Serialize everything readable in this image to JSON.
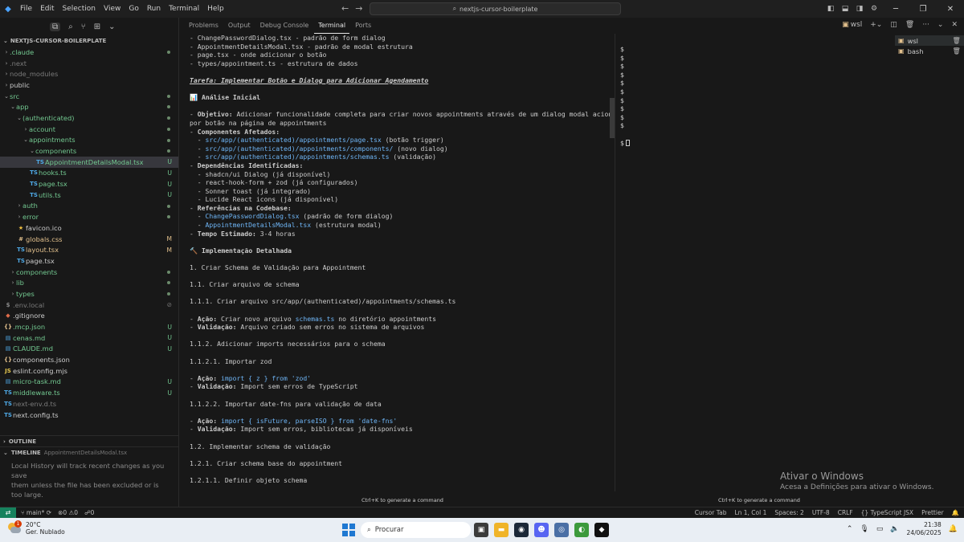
{
  "titlebar": {
    "menu": [
      "File",
      "Edit",
      "Selection",
      "View",
      "Go",
      "Run",
      "Terminal",
      "Help"
    ],
    "search": "nextjs-cursor-boilerplate"
  },
  "explorer": {
    "title": "NEXTJS-CURSOR-BOILERPLATE",
    "items": [
      {
        "name": ".claude",
        "depth": 0,
        "type": "folder",
        "open": false,
        "status": "dot",
        "color": "git"
      },
      {
        "name": ".next",
        "depth": 0,
        "type": "folder",
        "open": false,
        "status": "",
        "color": "dim"
      },
      {
        "name": "node_modules",
        "depth": 0,
        "type": "folder",
        "open": false,
        "status": "",
        "color": "dim"
      },
      {
        "name": "public",
        "depth": 0,
        "type": "folder",
        "open": false,
        "status": "",
        "color": "normal"
      },
      {
        "name": "src",
        "depth": 0,
        "type": "folder",
        "open": true,
        "status": "dot",
        "color": "git"
      },
      {
        "name": "app",
        "depth": 1,
        "type": "folder",
        "open": true,
        "status": "dot",
        "color": "git"
      },
      {
        "name": "(authenticated)",
        "depth": 2,
        "type": "folder",
        "open": true,
        "status": "dot",
        "color": "git"
      },
      {
        "name": "account",
        "depth": 3,
        "type": "folder",
        "open": false,
        "status": "dot",
        "color": "git"
      },
      {
        "name": "appointments",
        "depth": 3,
        "type": "folder",
        "open": true,
        "status": "dot",
        "color": "git"
      },
      {
        "name": "components",
        "depth": 4,
        "type": "folder",
        "open": true,
        "status": "dot",
        "color": "git"
      },
      {
        "name": "AppointmentDetailsModal.tsx",
        "depth": 5,
        "type": "tsx",
        "status": "U",
        "color": "git",
        "selected": true
      },
      {
        "name": "hooks.ts",
        "depth": 4,
        "type": "ts",
        "status": "U",
        "color": "git"
      },
      {
        "name": "page.tsx",
        "depth": 4,
        "type": "tsx",
        "status": "U",
        "color": "git"
      },
      {
        "name": "utils.ts",
        "depth": 4,
        "type": "ts",
        "status": "U",
        "color": "git"
      },
      {
        "name": "auth",
        "depth": 2,
        "type": "folder",
        "open": false,
        "status": "dot",
        "color": "git"
      },
      {
        "name": "error",
        "depth": 2,
        "type": "folder",
        "open": false,
        "status": "dot",
        "color": "git"
      },
      {
        "name": "favicon.ico",
        "depth": 2,
        "type": "ico",
        "status": "",
        "color": "normal"
      },
      {
        "name": "globals.css",
        "depth": 2,
        "type": "css",
        "status": "M",
        "color": "mod"
      },
      {
        "name": "layout.tsx",
        "depth": 2,
        "type": "tsx",
        "status": "M",
        "color": "mod"
      },
      {
        "name": "page.tsx",
        "depth": 2,
        "type": "tsx",
        "status": "",
        "color": "normal"
      },
      {
        "name": "components",
        "depth": 1,
        "type": "folder",
        "open": false,
        "status": "dot",
        "color": "git"
      },
      {
        "name": "lib",
        "depth": 1,
        "type": "folder",
        "open": false,
        "status": "dot",
        "color": "git"
      },
      {
        "name": "types",
        "depth": 1,
        "type": "folder",
        "open": false,
        "status": "dot",
        "color": "git"
      },
      {
        "name": ".env.local",
        "depth": 0,
        "type": "env",
        "status": "ignored",
        "color": "dim"
      },
      {
        "name": ".gitignore",
        "depth": 0,
        "type": "git",
        "status": "",
        "color": "normal"
      },
      {
        "name": ".mcp.json",
        "depth": 0,
        "type": "json",
        "status": "U",
        "color": "git"
      },
      {
        "name": "cenas.md",
        "depth": 0,
        "type": "md",
        "status": "U",
        "color": "git"
      },
      {
        "name": "CLAUDE.md",
        "depth": 0,
        "type": "md",
        "status": "U",
        "color": "git"
      },
      {
        "name": "components.json",
        "depth": 0,
        "type": "json",
        "status": "",
        "color": "normal"
      },
      {
        "name": "eslint.config.mjs",
        "depth": 0,
        "type": "mjs",
        "status": "",
        "color": "normal"
      },
      {
        "name": "micro-task.md",
        "depth": 0,
        "type": "md",
        "status": "U",
        "color": "git"
      },
      {
        "name": "middleware.ts",
        "depth": 0,
        "type": "ts",
        "status": "U",
        "color": "git"
      },
      {
        "name": "next-env.d.ts",
        "depth": 0,
        "type": "ts",
        "status": "",
        "color": "dim"
      },
      {
        "name": "next.config.ts",
        "depth": 0,
        "type": "ts",
        "status": "",
        "color": "normal"
      }
    ]
  },
  "outline": {
    "title": "OUTLINE"
  },
  "timeline": {
    "title": "TIMELINE",
    "file": "AppointmentDetailsModal.tsx",
    "message_line1": "Local History will track recent changes as you save",
    "message_line2": "them unless the file has been excluded or is too large."
  },
  "panel": {
    "tabs": [
      "Problems",
      "Output",
      "Debug Console",
      "Terminal",
      "Ports"
    ],
    "active_tab": "Terminal"
  },
  "terminal_lines": [
    [
      {
        "t": "- ChangePasswordDialog.tsx - padrão de form dialog"
      }
    ],
    [
      {
        "t": "- AppointmentDetailsModal.tsx - padrão de modal estrutura"
      }
    ],
    [
      {
        "t": "- page.tsx - onde adicionar o botão"
      }
    ],
    [
      {
        "t": "- types/appointment.ts - estrutura de dados"
      }
    ],
    [],
    [
      {
        "t": "Tarefa: Implementar Botão e Dialog para Adicionar Agendamento",
        "s": "u"
      }
    ],
    [],
    [
      {
        "t": "📊 Análise Inicial",
        "s": "b"
      }
    ],
    [],
    [
      {
        "t": "- "
      },
      {
        "t": "Objetivo:",
        "s": "b"
      },
      {
        "t": " Adicionar funcionalidade completa para criar novos appointments através de um dialog modal acionado"
      }
    ],
    [
      {
        "t": "por botão na página de appointments"
      }
    ],
    [
      {
        "t": "- "
      },
      {
        "t": "Componentes Afetados:",
        "s": "b"
      }
    ],
    [
      {
        "t": "  - "
      },
      {
        "t": "src/app/(authenticated)/appointments/page.tsx",
        "s": "c"
      },
      {
        "t": " (botão trigger)"
      }
    ],
    [
      {
        "t": "  - "
      },
      {
        "t": "src/app/(authenticated)/appointments/components/",
        "s": "c"
      },
      {
        "t": " (novo dialog)"
      }
    ],
    [
      {
        "t": "  - "
      },
      {
        "t": "src/app/(authenticated)/appointments/schemas.ts",
        "s": "c"
      },
      {
        "t": " (validação)"
      }
    ],
    [
      {
        "t": "- "
      },
      {
        "t": "Dependências Identificadas:",
        "s": "b"
      }
    ],
    [
      {
        "t": "  - shadcn/ui Dialog (já disponível)"
      }
    ],
    [
      {
        "t": "  - react-hook-form + zod (já configurados)"
      }
    ],
    [
      {
        "t": "  - Sonner toast (já integrado)"
      }
    ],
    [
      {
        "t": "  - Lucide React icons (já disponível)"
      }
    ],
    [
      {
        "t": "- "
      },
      {
        "t": "Referências na Codebase:",
        "s": "b"
      }
    ],
    [
      {
        "t": "  - "
      },
      {
        "t": "ChangePasswordDialog.tsx",
        "s": "c"
      },
      {
        "t": " (padrão de form dialog)"
      }
    ],
    [
      {
        "t": "  - "
      },
      {
        "t": "AppointmentDetailsModal.tsx",
        "s": "c"
      },
      {
        "t": " (estrutura modal)"
      }
    ],
    [
      {
        "t": "- "
      },
      {
        "t": "Tempo Estimado:",
        "s": "b"
      },
      {
        "t": " 3-4 horas"
      }
    ],
    [],
    [
      {
        "t": "🔨 Implementação Detalhada",
        "s": "b"
      }
    ],
    [],
    [
      {
        "t": "1. Criar Schema de Validação para Appointment"
      }
    ],
    [],
    [
      {
        "t": "1.1. Criar arquivo de schema"
      }
    ],
    [],
    [
      {
        "t": "1.1.1. Criar arquivo src/app/(authenticated)/appointments/schemas.ts"
      }
    ],
    [],
    [
      {
        "t": "- "
      },
      {
        "t": "Ação:",
        "s": "b"
      },
      {
        "t": " Criar novo arquivo "
      },
      {
        "t": "schemas.ts",
        "s": "c"
      },
      {
        "t": " no diretório appointments"
      }
    ],
    [
      {
        "t": "- "
      },
      {
        "t": "Validação:",
        "s": "b"
      },
      {
        "t": " Arquivo criado sem erros no sistema de arquivos"
      }
    ],
    [],
    [
      {
        "t": "1.1.2. Adicionar imports necessários para o schema"
      }
    ],
    [],
    [
      {
        "t": "1.1.2.1. Importar zod"
      }
    ],
    [],
    [
      {
        "t": "- "
      },
      {
        "t": "Ação:",
        "s": "b"
      },
      {
        "t": " "
      },
      {
        "t": "import { z } from 'zod'",
        "s": "c"
      }
    ],
    [
      {
        "t": "- "
      },
      {
        "t": "Validação:",
        "s": "b"
      },
      {
        "t": " Import sem erros de TypeScript"
      }
    ],
    [],
    [
      {
        "t": "1.1.2.2. Importar date-fns para validação de data"
      }
    ],
    [],
    [
      {
        "t": "- "
      },
      {
        "t": "Ação:",
        "s": "b"
      },
      {
        "t": " "
      },
      {
        "t": "import { isFuture, parseISO } from 'date-fns'",
        "s": "c"
      }
    ],
    [
      {
        "t": "- "
      },
      {
        "t": "Validação:",
        "s": "b"
      },
      {
        "t": " Import sem erros, bibliotecas já disponíveis"
      }
    ],
    [],
    [
      {
        "t": "1.2. Implementar schema de validação"
      }
    ],
    [],
    [
      {
        "t": "1.2.1. Criar schema base do appointment"
      }
    ],
    [],
    [
      {
        "t": "1.2.1.1. Definir objeto schema"
      }
    ]
  ],
  "right_terminal": {
    "prompt": "$",
    "prompt_count": 10,
    "cursor_prompt": "$"
  },
  "terminal_list": [
    {
      "name": "wsl",
      "active": true
    },
    {
      "name": "bash",
      "active": false
    }
  ],
  "panel_actions": {
    "current": "wsl"
  },
  "hints": {
    "left": "Ctrl+K to generate a command",
    "right": "Ctrl+K to generate a command"
  },
  "watermark": {
    "line1": "Ativar o Windows",
    "line2": "Acesa a Definições para ativar o Windows."
  },
  "statusbar": {
    "branch": "main*",
    "errors": "0",
    "warnings": "0",
    "ports": "0",
    "right": [
      "Cursor Tab",
      "Ln 1, Col 1",
      "Spaces: 2",
      "UTF-8",
      "CRLF",
      "{} TypeScript JSX",
      "Prettier"
    ]
  },
  "taskbar": {
    "temperature": "20°C",
    "weather": "Ger. Nublado",
    "weather_badge": "1",
    "search_placeholder": "Procurar",
    "time": "21:38",
    "date": "24/06/2025"
  }
}
